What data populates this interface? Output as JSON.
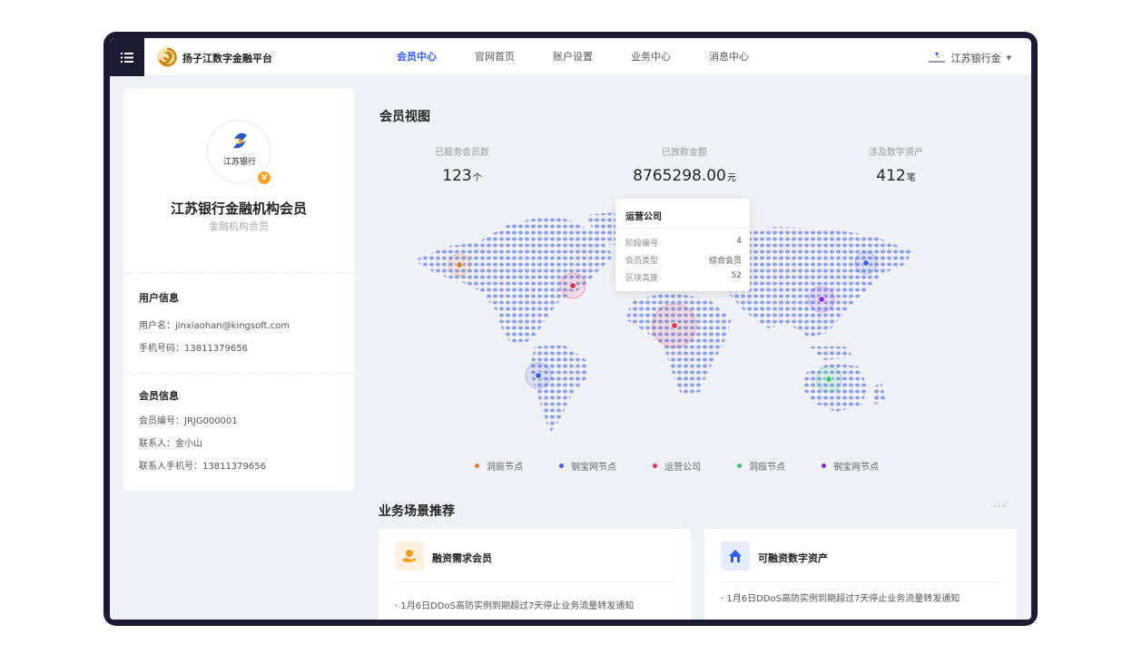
{
  "header": {
    "brand": "扬子江数字金融平台",
    "nav": [
      "会员中心",
      "官网首页",
      "账户设置",
      "业务中心",
      "消息中心"
    ],
    "active_nav": 0,
    "user": "江苏银行金"
  },
  "profile": {
    "avatar_text": "江苏银行",
    "badge": "V",
    "org_name": "江苏银行金融机构会员",
    "org_type": "金融机构会员",
    "user_section": "用户信息",
    "username": "用户名：jinxiaohan@kingsoft.com",
    "phone": "手机号码：13811379656",
    "member_section": "会员信息",
    "member_no": "会员编号：JRJG000001",
    "contact": "联系人：金小山",
    "contact_phone": "联系人手机号：13811379656"
  },
  "overview": {
    "title": "会员视图",
    "stats": [
      {
        "label": "已服务会员数",
        "value": "123",
        "unit": "个"
      },
      {
        "label": "已放款金额",
        "value": "8765298.00",
        "unit": "元"
      },
      {
        "label": "涉及数字资产",
        "value": "412",
        "unit": "笔"
      }
    ]
  },
  "tooltip": {
    "title": "运营公司",
    "rows": [
      {
        "k": "阶段编号",
        "v": "4"
      },
      {
        "k": "会员类型",
        "v": "综合会员"
      },
      {
        "k": "区块高度",
        "v": "52"
      }
    ]
  },
  "legend": [
    {
      "label": "洞辰节点",
      "color": "#e8792b"
    },
    {
      "label": "钢宝网节点",
      "color": "#3f5ee8"
    },
    {
      "label": "运营公司",
      "color": "#e0344a"
    },
    {
      "label": "洞辰节点",
      "color": "#3cc36e"
    },
    {
      "label": "钢宝网节点",
      "color": "#8a2be0"
    }
  ],
  "scenes": {
    "title": "业务场景推荐",
    "more": "···",
    "cards": [
      {
        "title": "融资需求会员",
        "icon": "hand-coin-icon",
        "item": "·  1月6日DDoS高防实例到期超过7天停止业务流量转发通知"
      },
      {
        "title": "可融资数字资产",
        "icon": "house-icon",
        "item": "·  1月6日DDoS高防实例到期超过7天停止业务流量转发通知"
      }
    ]
  }
}
